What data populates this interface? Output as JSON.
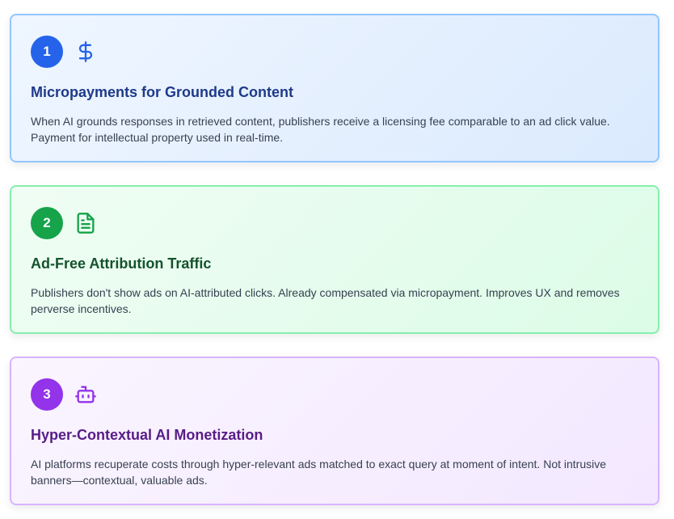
{
  "cards": [
    {
      "number": "1",
      "icon": "dollar-sign-icon",
      "title": "Micropayments for Grounded Content",
      "description": "When AI grounds responses in retrieved content, publishers receive a licensing fee comparable to an ad click value. Payment for intellectual property used in real-time.",
      "theme": {
        "accent": "#2563eb",
        "border": "#93c5fd",
        "title": "#1e3a8a"
      }
    },
    {
      "number": "2",
      "icon": "document-icon",
      "title": "Ad-Free Attribution Traffic",
      "description": "Publishers don't show ads on AI-attributed clicks. Already compensated via micropayment. Improves UX and removes perverse incentives.",
      "theme": {
        "accent": "#16a34a",
        "border": "#86efac",
        "title": "#14532d"
      }
    },
    {
      "number": "3",
      "icon": "robot-icon",
      "title": "Hyper-Contextual AI Monetization",
      "description": "AI platforms recuperate costs through hyper-relevant ads matched to exact query at moment of intent. Not intrusive banners—contextual, valuable ads.",
      "theme": {
        "accent": "#9333ea",
        "border": "#d8b4fe",
        "title": "#581c87"
      }
    }
  ]
}
